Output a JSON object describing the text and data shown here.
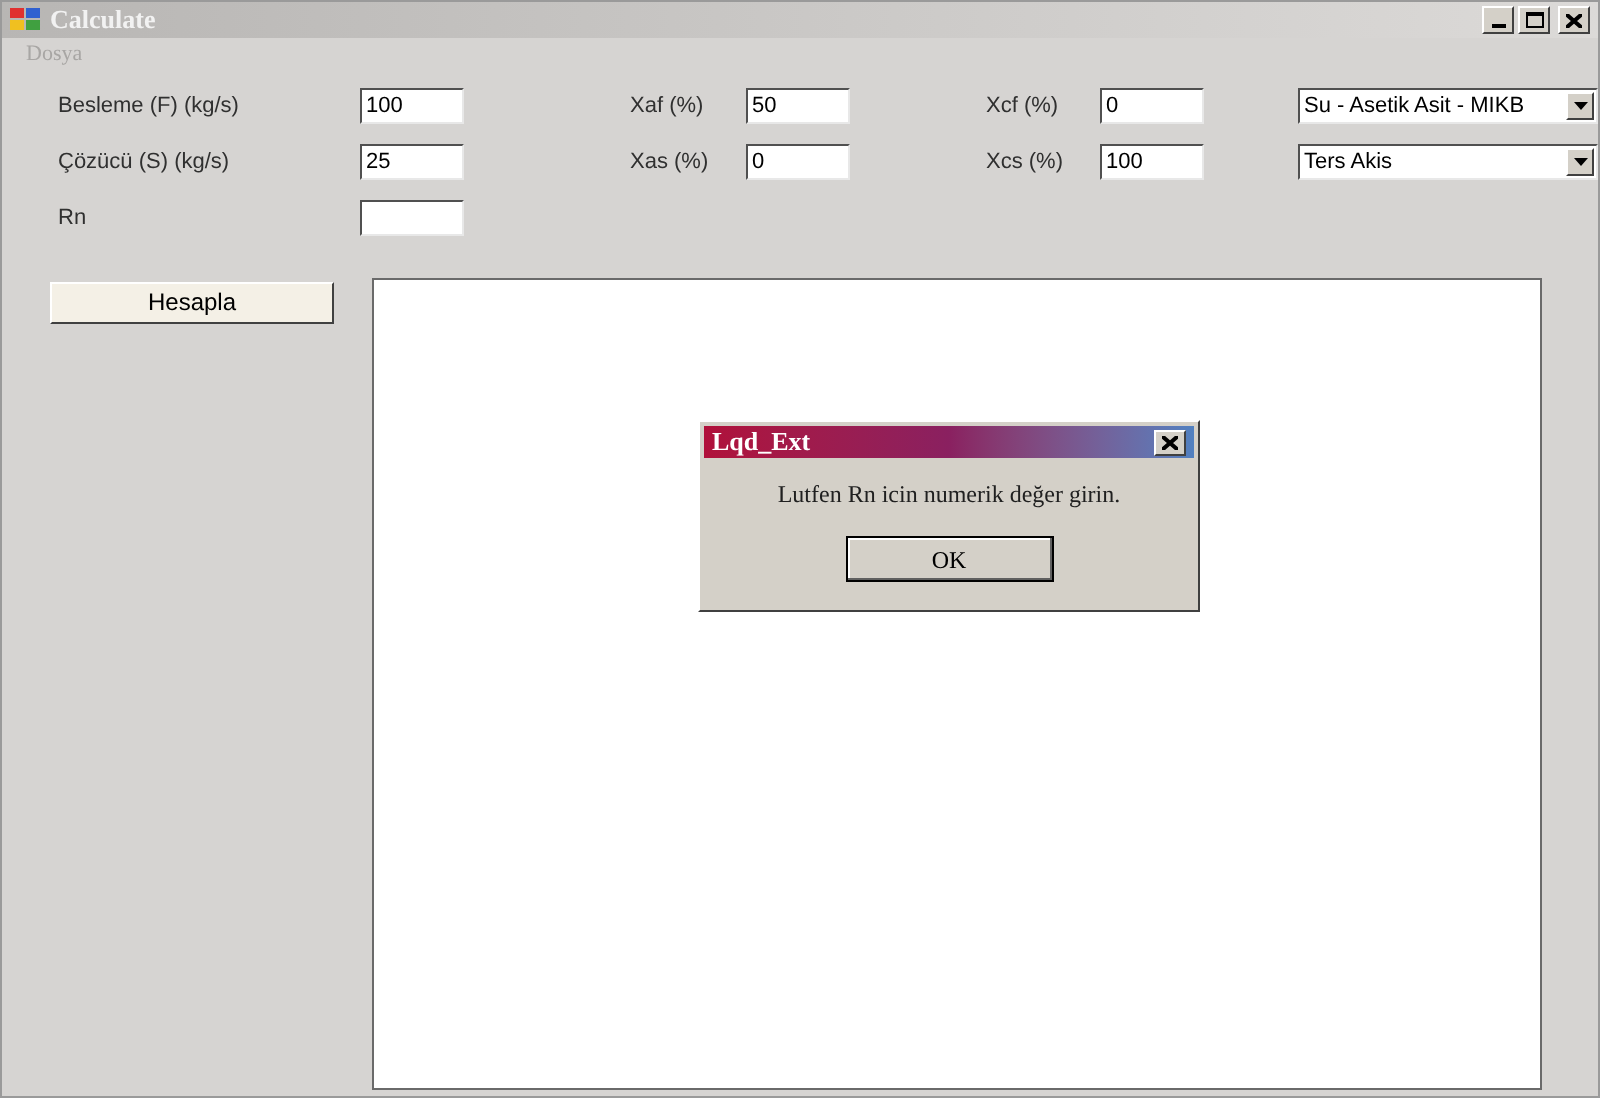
{
  "window": {
    "title": "Calculate"
  },
  "menu": [
    "Dosya"
  ],
  "rows": [
    {
      "fields": [
        {
          "label": "Besleme (F) (kg/s)",
          "value": "100"
        },
        {
          "label": "Xaf (%)",
          "value": "50"
        },
        {
          "label": "Xcf (%)",
          "value": "0"
        }
      ],
      "dropdown": {
        "value": "Su - Asetik Asit - MIKB"
      }
    },
    {
      "fields": [
        {
          "label": "Çözücü (S) (kg/s)",
          "value": "25"
        },
        {
          "label": "Xas (%)",
          "value": "0"
        },
        {
          "label": "Xcs (%)",
          "value": "100"
        }
      ],
      "dropdown": {
        "value": "Ters Akis"
      }
    },
    {
      "fields": [
        {
          "label": "Rn"
        }
      ]
    }
  ],
  "button": "Hesapla",
  "dialog": {
    "title": "Lqd_Ext",
    "message": "Lutfen Rn icin numerik değer girin.",
    "button": "OK"
  }
}
